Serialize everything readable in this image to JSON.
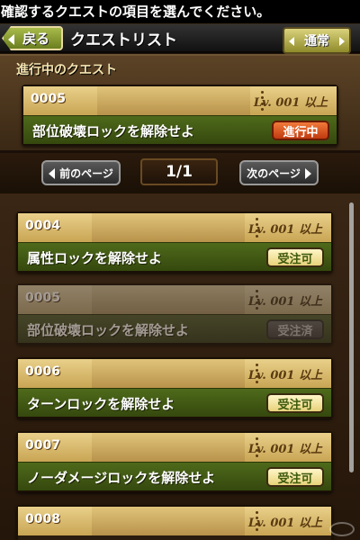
{
  "instruction": "確認するクエストの項目を選んでください。",
  "header": {
    "back_label": "戻る",
    "title": "クエストリスト",
    "mode_label": "通常"
  },
  "in_progress": {
    "section_title": "進行中のクエスト",
    "quest": {
      "number": "0005",
      "level": "Lv. 001 以上",
      "name": "部位破壊ロックを解除せよ",
      "status": "進行中"
    }
  },
  "pager": {
    "prev_label": "前のページ",
    "page": "1/1",
    "next_label": "次のページ"
  },
  "quests": [
    {
      "number": "0004",
      "level": "Lv. 001 以上",
      "name": "属性ロックを解除せよ",
      "status": "受注可"
    },
    {
      "number": "0005",
      "level": "Lv. 001 以上",
      "name": "部位破壊ロックを解除せよ",
      "status": "受注済"
    },
    {
      "number": "0006",
      "level": "Lv. 001 以上",
      "name": "ターンロックを解除せよ",
      "status": "受注可"
    },
    {
      "number": "0007",
      "level": "Lv. 001 以上",
      "name": "ノーダメージロックを解除せよ",
      "status": "受注可"
    },
    {
      "number": "0008",
      "level": "Lv. 001 以上",
      "name": "",
      "status": ""
    }
  ],
  "colors": {
    "status_available": "#e7d27a",
    "status_active": "#d0501c",
    "status_taken": "#555555"
  }
}
